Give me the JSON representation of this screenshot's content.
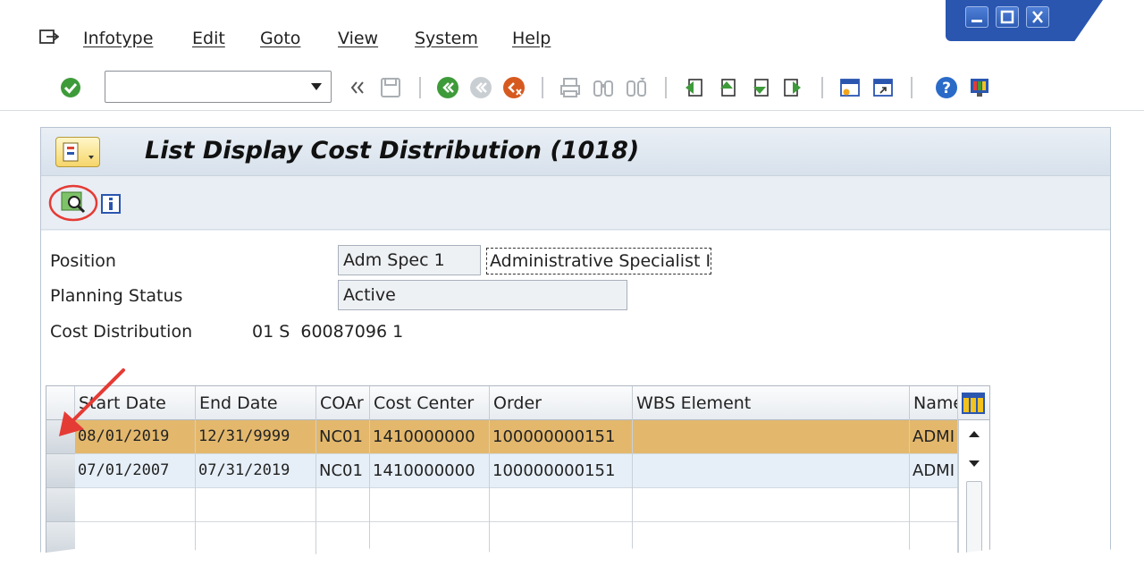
{
  "menu": {
    "items": [
      "Infotype",
      "Edit",
      "Goto",
      "View",
      "System",
      "Help"
    ]
  },
  "toolbar": {
    "command_value": "",
    "icons": [
      "enter-check-icon",
      "back-double-icon",
      "save-icon",
      "back-icon",
      "exit-icon",
      "cancel-icon",
      "print-icon",
      "find-icon",
      "find-next-icon",
      "first-page-icon",
      "prev-page-icon",
      "next-page-icon",
      "last-page-icon",
      "create-session-icon",
      "shortcut-icon",
      "help-icon",
      "customize-layout-icon"
    ]
  },
  "screen": {
    "title": "List Display Cost Distribution (1018)"
  },
  "form": {
    "position_label": "Position",
    "position_value": "Adm Spec 1",
    "position_desc": "Administrative Specialist I",
    "planning_status_label": "Planning Status",
    "planning_status_value": "Active",
    "cost_distribution_label": "Cost Distribution",
    "cost_distribution_value": "01 S  60087096 1"
  },
  "grid": {
    "columns": [
      "Start Date",
      "End Date",
      "COAr",
      "Cost Center",
      "Order",
      "WBS Element",
      "Name"
    ],
    "rows": [
      {
        "start": "08/01/2019",
        "end": "12/31/9999",
        "coar": "NC01",
        "cost_center": "1410000000",
        "order": "100000000151",
        "wbs": "",
        "name": "ADMI"
      },
      {
        "start": "07/01/2007",
        "end": "07/31/2019",
        "coar": "NC01",
        "cost_center": "1410000000",
        "order": "100000000151",
        "wbs": "",
        "name": "ADMI"
      }
    ]
  },
  "colors": {
    "selected_row": "#e3b86d",
    "alt_row": "#e6eff7",
    "annotation_red": "#e53b35"
  }
}
